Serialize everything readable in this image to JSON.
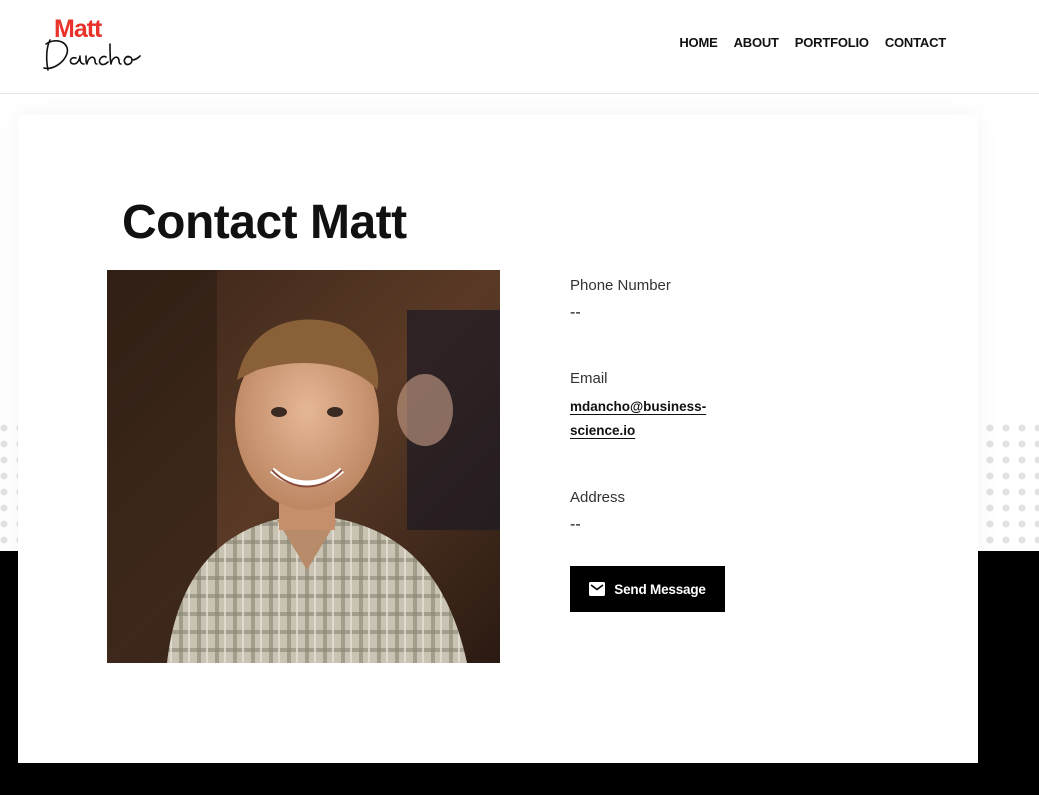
{
  "logo": {
    "line1": "Matt",
    "line2": "Dancho",
    "top_color": "#e8322b",
    "script_color": "#111111"
  },
  "nav": {
    "items": [
      "HOME",
      "ABOUT",
      "PORTFOLIO",
      "CONTACT"
    ]
  },
  "page": {
    "title": "Contact Matt"
  },
  "contact": {
    "phone_label": "Phone Number",
    "phone_value": "--",
    "email_label": "Email",
    "email_value": "mdancho@business-science.io",
    "address_label": "Address",
    "address_value": "--"
  },
  "button": {
    "send_label": "Send Message",
    "icon": "envelope-icon"
  },
  "colors": {
    "accent": "#e8322b",
    "dark": "#000000",
    "background": "#ffffff"
  }
}
